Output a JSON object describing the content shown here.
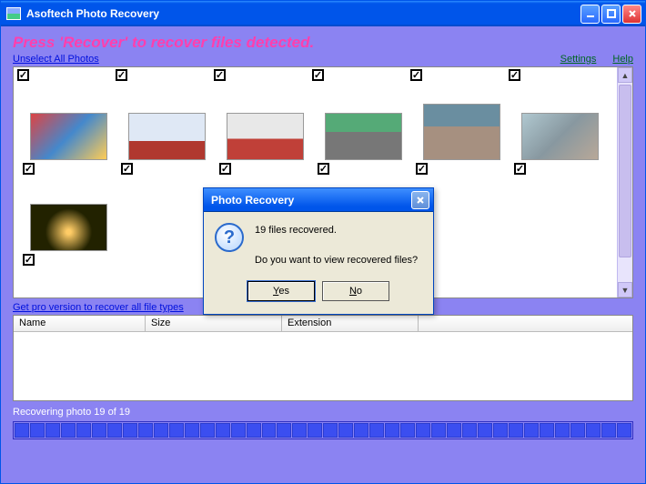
{
  "titlebar": {
    "title": "Asoftech Photo Recovery"
  },
  "instruction": "Press 'Recover' to recover files detected.",
  "links": {
    "unselect": "Unselect All Photos",
    "settings": "Settings",
    "help": "Help",
    "pro": "Get pro version to recover all file types"
  },
  "listview": {
    "cols": {
      "name": "Name",
      "size": "Size",
      "ext": "Extension"
    }
  },
  "status": "Recovering photo 19 of 19",
  "dialog": {
    "title": "Photo Recovery",
    "line1": "19 files recovered.",
    "line2": "Do you want to view recovered files?",
    "yes": "Yes",
    "no": "No"
  }
}
